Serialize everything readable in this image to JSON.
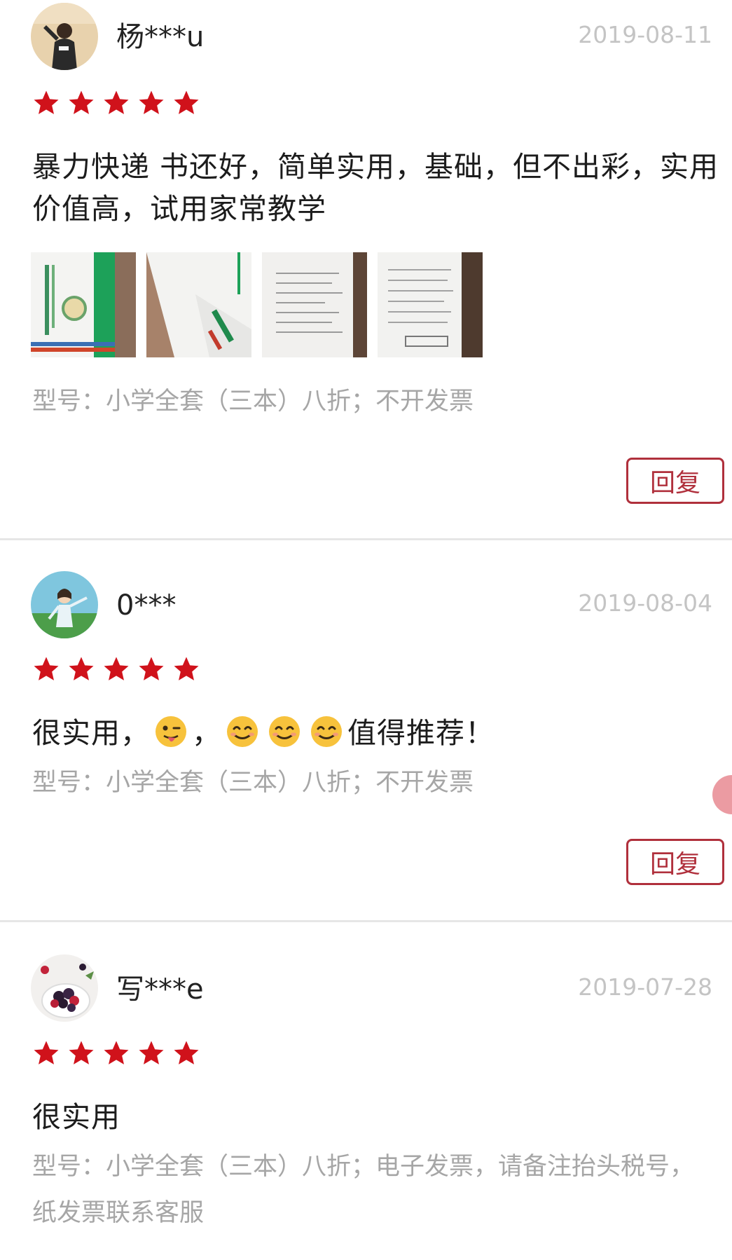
{
  "reviews": [
    {
      "username": "杨***u",
      "date": "2019-08-11",
      "rating": 5,
      "content": "暴力快递 书还好，简单实用，基础，但不出彩，实用价值高，试用家常教学",
      "model": "型号：小学全套（三本）八折；不开发票",
      "reply_label": "回复",
      "photo_count": 4
    },
    {
      "username": "0***",
      "date": "2019-08-04",
      "rating": 5,
      "content_parts": [
        "很实用，",
        "，",
        "值得推荐！"
      ],
      "emojis": [
        "winking-tongue-emoji",
        "smiling-emoji",
        "smiling-emoji",
        "smiling-emoji"
      ],
      "model": "型号：小学全套（三本）八折；不开发票",
      "reply_label": "回复"
    },
    {
      "username": "写***e",
      "date": "2019-07-28",
      "rating": 5,
      "content": "很实用",
      "model": "型号：小学全套（三本）八折；电子发票，请备注抬头税号，纸发票联系客服"
    }
  ],
  "colors": {
    "star": "#d0121b",
    "reply_border": "#b0303c",
    "date": "#c4c4c4",
    "model": "#a6a6a6"
  }
}
